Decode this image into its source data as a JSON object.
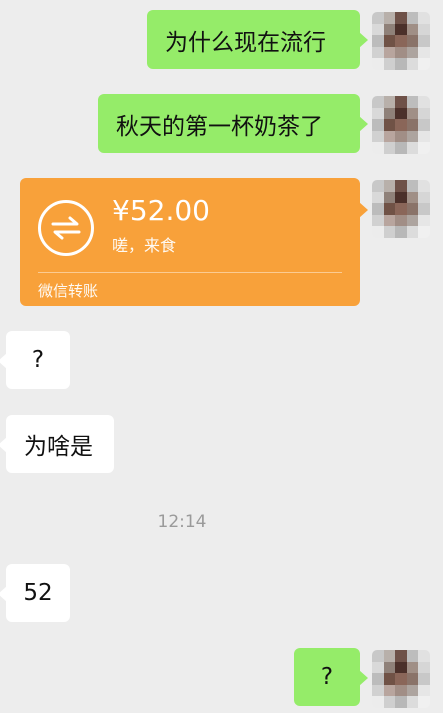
{
  "messages": [
    {
      "side": "right",
      "text": "为什么现在流行"
    },
    {
      "side": "right",
      "text": "秋天的第一杯奶茶了"
    },
    {
      "side": "left",
      "text": "?"
    },
    {
      "side": "left",
      "text": "为啥是"
    },
    {
      "side": "left",
      "text": "52"
    },
    {
      "side": "right",
      "text": "?"
    }
  ],
  "transfer": {
    "amount": "¥52.00",
    "note": "嗟，来食",
    "footer": "微信转账"
  },
  "timestamp": "12:14",
  "colors": {
    "background": "#ededed",
    "sent_bubble": "#95ec69",
    "received_bubble": "#ffffff",
    "transfer_card": "#f8a13a"
  }
}
